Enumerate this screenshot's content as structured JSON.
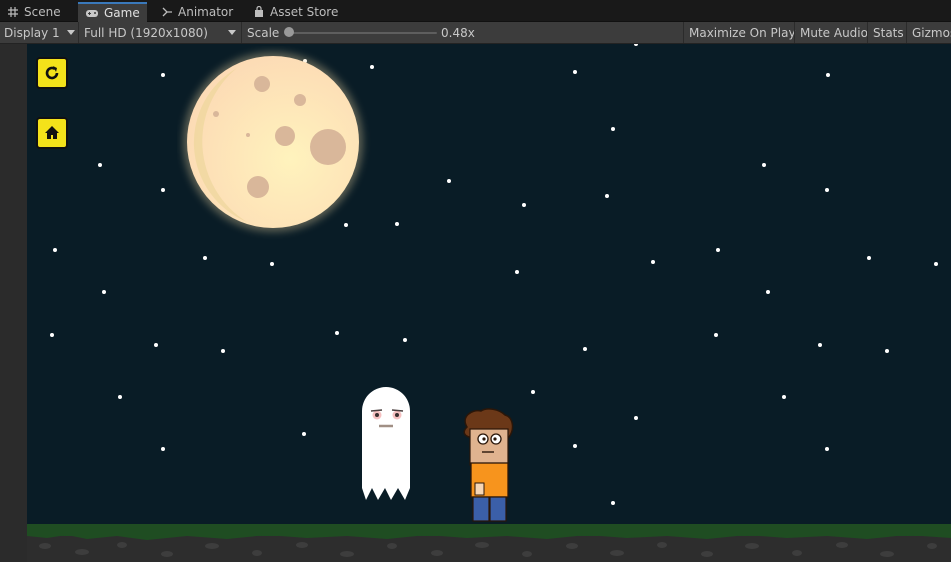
{
  "tabs": [
    {
      "label": "Scene",
      "icon": "grid-icon"
    },
    {
      "label": "Game",
      "icon": "gamepad-icon"
    },
    {
      "label": "Animator",
      "icon": "animator-icon"
    },
    {
      "label": "Asset Store",
      "icon": "store-bag-icon"
    }
  ],
  "toolbar": {
    "display": "Display 1",
    "resolution": "Full HD (1920x1080)",
    "scale_label": "Scale",
    "scale_value": "0.48x",
    "maximize": "Maximize On Play",
    "mute": "Mute Audio",
    "stats": "Stats",
    "gizmos": "Gizmos"
  },
  "game": {
    "background_color": "#091c26",
    "ui_button_color": "#f4e21a",
    "buttons": [
      "restart-icon",
      "home-icon"
    ]
  }
}
